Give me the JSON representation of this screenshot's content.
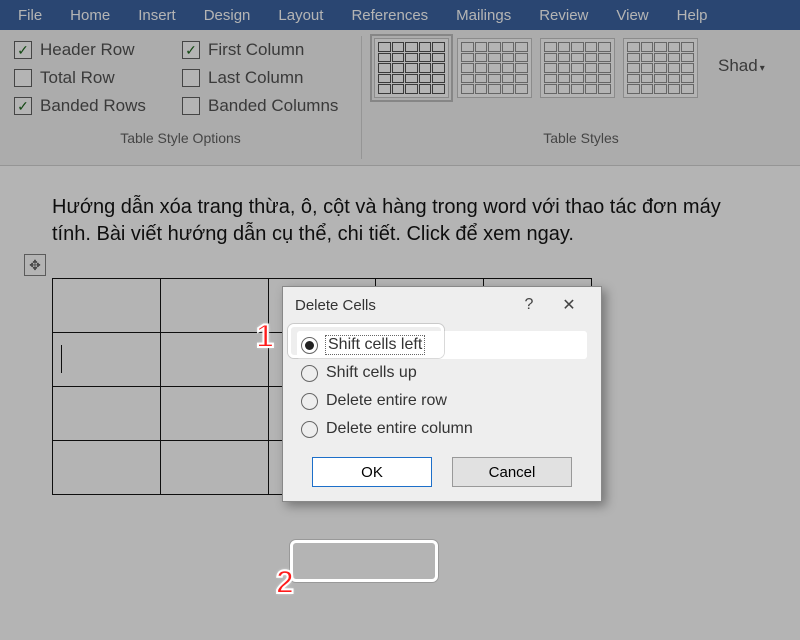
{
  "tabs": [
    "File",
    "Home",
    "Insert",
    "Design",
    "Layout",
    "References",
    "Mailings",
    "Review",
    "View",
    "Help"
  ],
  "opts": {
    "headerRow": {
      "label": "Header Row",
      "checked": true
    },
    "totalRow": {
      "label": "Total Row",
      "checked": false
    },
    "bandedRows": {
      "label": "Banded Rows",
      "checked": true
    },
    "firstCol": {
      "label": "First Column",
      "checked": true
    },
    "lastCol": {
      "label": "Last Column",
      "checked": false
    },
    "bandedCols": {
      "label": "Banded Columns",
      "checked": false
    },
    "groupLabel": "Table Style Options"
  },
  "styles": {
    "groupLabel": "Table Styles",
    "shading": "Shad"
  },
  "doc": {
    "para": "Hướng dẫn xóa trang thừa, ô, cột và hàng trong word với thao tác đơn máy tính. Bài viết hướng dẫn cụ thể, chi tiết. Click để xem ngay."
  },
  "dialog": {
    "title": "Delete Cells",
    "help": "?",
    "close": "✕",
    "opt1": "Shift cells left",
    "opt2": "Shift cells up",
    "opt3": "Delete entire row",
    "opt4": "Delete entire column",
    "ok": "OK",
    "cancel": "Cancel"
  },
  "callouts": {
    "one": "1",
    "two": "2"
  }
}
